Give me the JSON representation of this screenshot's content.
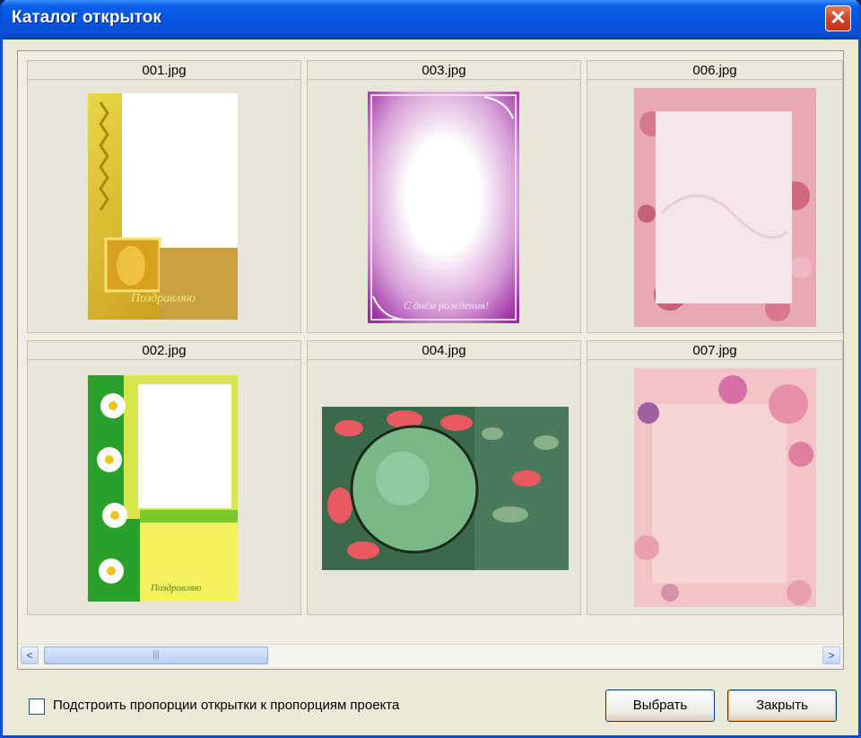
{
  "window": {
    "title": "Каталог открыток",
    "close_glyph": "✕"
  },
  "cards": [
    {
      "filename": "001.jpg"
    },
    {
      "filename": "003.jpg"
    },
    {
      "filename": "006.jpg"
    },
    {
      "filename": "002.jpg"
    },
    {
      "filename": "004.jpg"
    },
    {
      "filename": "007.jpg"
    }
  ],
  "scrollbar": {
    "left_arrow": "<",
    "right_arrow": ">",
    "grip": "|||"
  },
  "options": {
    "fit_proportions_label": "Подстроить пропорции открытки к пропорциям проекта",
    "fit_proportions_checked": false
  },
  "buttons": {
    "select_label": "Выбрать",
    "close_label": "Закрыть"
  },
  "colors": {
    "titlebar": "#0a5fe8",
    "dialog_bg": "#ece9d8"
  }
}
